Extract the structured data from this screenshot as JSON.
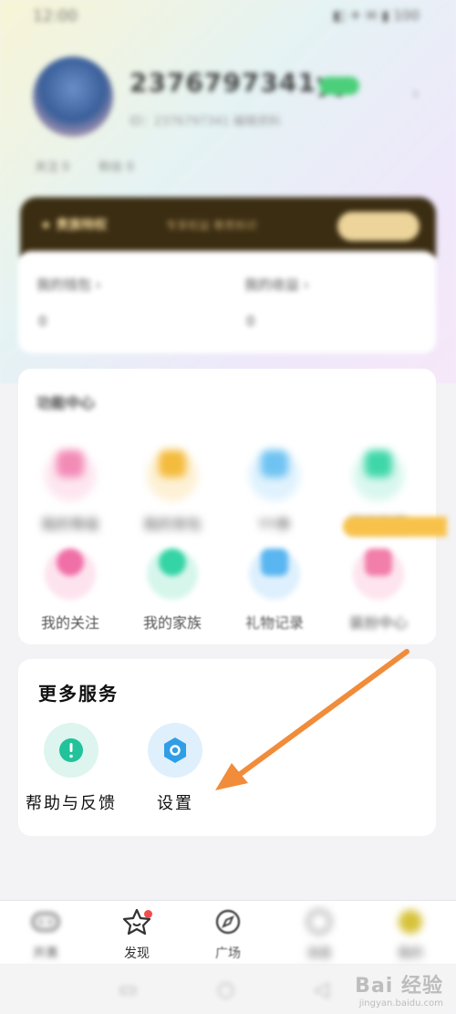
{
  "status_bar": {
    "time": "12:00",
    "right": "◧ ✈ ✉ ▮ 100"
  },
  "profile": {
    "username": "2376797341yy",
    "subtitle": "ID：2376797341 编辑资料",
    "stats": [
      "关注 0",
      "粉丝 0"
    ]
  },
  "banner": {
    "title": "★ 贵族特权",
    "middle": "专享权益   尊贵标识"
  },
  "wallet": {
    "items": [
      {
        "label": "我的钱包",
        "value": "0"
      },
      {
        "label": "我的收益",
        "value": "0"
      }
    ]
  },
  "features": {
    "title": "功能中心",
    "items": [
      {
        "label": "我的等级",
        "color": "#f38bb7"
      },
      {
        "label": "我的背包",
        "color": "#f4bb3c"
      },
      {
        "label": "YY券",
        "color": "#6fc3f2"
      },
      {
        "label": "我的勋章",
        "color": "#3fd7a8"
      },
      {
        "label": "我的关注",
        "color": "#f06fa7"
      },
      {
        "label": "我的家族",
        "color": "#34d4a5"
      },
      {
        "label": "礼物记录",
        "color": "#5ab6f0"
      },
      {
        "label": "装扮中心",
        "color": "#f27eaa"
      }
    ]
  },
  "more_services": {
    "title": "更多服务",
    "items": [
      {
        "label": "帮助与反馈",
        "icon": "help-icon",
        "color": "#22c29a"
      },
      {
        "label": "设置",
        "icon": "settings-icon",
        "color": "#2f9ee6"
      }
    ]
  },
  "annotation_color": "#f08c3a",
  "tabbar": {
    "items": [
      {
        "label": "开黑",
        "icon": "gamepad-icon"
      },
      {
        "label": "发现",
        "icon": "star-face-icon",
        "badge": true
      },
      {
        "label": "广场",
        "icon": "compass-icon"
      },
      {
        "label": "消息",
        "icon": "message-icon"
      },
      {
        "label": "我的",
        "icon": "me-avatar-icon"
      }
    ]
  },
  "watermark": {
    "text": "Bai 经验",
    "sub": "jingyan.baidu.com"
  }
}
